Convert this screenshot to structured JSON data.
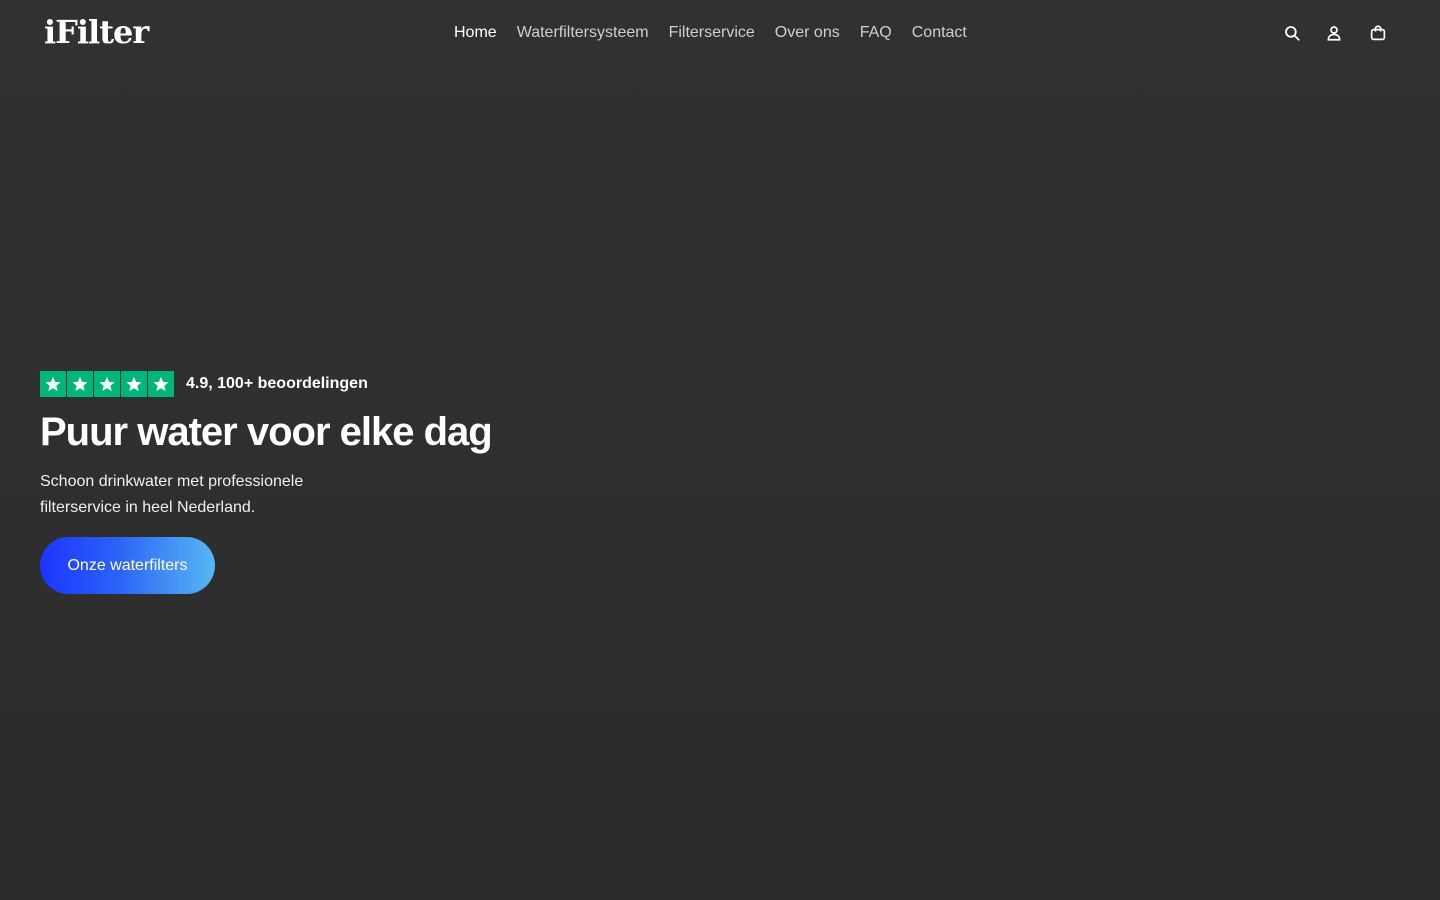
{
  "header": {
    "logo_text": "iFilter",
    "nav": [
      {
        "label": "Home",
        "active": true
      },
      {
        "label": "Waterfiltersysteem",
        "active": false
      },
      {
        "label": "Filterservice",
        "active": false
      },
      {
        "label": "Over ons",
        "active": false
      },
      {
        "label": "FAQ",
        "active": false
      },
      {
        "label": "Contact",
        "active": false
      }
    ],
    "icons": [
      "search-icon",
      "account-icon",
      "cart-icon"
    ]
  },
  "hero": {
    "rating_stars": 5,
    "rating_text": "4.9, 100+ beoordelingen",
    "headline": "Puur water voor elke dag",
    "subtext": "Schoon drinkwater met professionele filterservice in heel Nederland.",
    "cta_label": "Onze waterfilters"
  },
  "colors": {
    "background": "#2f2f2f",
    "star_green": "#00b67a",
    "cta_gradient_start": "#1b35ff",
    "cta_gradient_end": "#56b8f4",
    "nav_text": "#cfcfcf"
  }
}
